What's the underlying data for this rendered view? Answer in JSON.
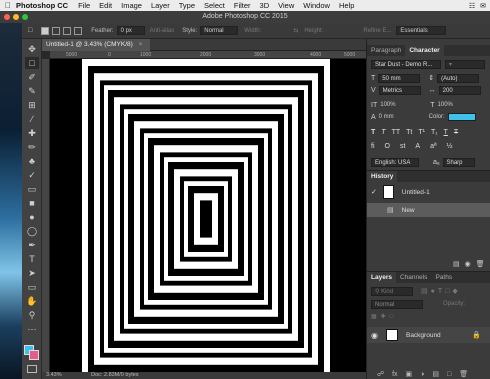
{
  "menubar": {
    "app_name": "Photoshop CC",
    "items": [
      "File",
      "Edit",
      "Image",
      "Layer",
      "Type",
      "Select",
      "Filter",
      "3D",
      "View",
      "Window",
      "Help"
    ]
  },
  "window": {
    "title": "Adobe Photoshop CC 2015"
  },
  "options": {
    "feather_label": "Feather:",
    "feather_value": "0 px",
    "antialias_label": "Anti-alias",
    "style_label": "Style:",
    "style_value": "Normal",
    "width_label": "Width:",
    "height_label": "Height:",
    "refine_label": "Refine E...",
    "workspace_value": "Essentials"
  },
  "document": {
    "tab_label": "Untitled-1 @ 3.43% (CMYK/8)",
    "ruler_ticks": [
      "5000",
      "0",
      "1000",
      "2000",
      "3000",
      "4000",
      "5000"
    ],
    "status_zoom": "3.43%",
    "status_doc": "Doc: 2.83M/0 bytes"
  },
  "character_panel": {
    "tabs": [
      "Paragraph",
      "Character"
    ],
    "font_family": "Star Dust - Demo R...",
    "font_size": "50 mm",
    "leading": "(Auto)",
    "kerning": "Metrics",
    "tracking": "200",
    "vertical_scale": "100%",
    "horizontal_scale": "100%",
    "baseline_shift": "0 mm",
    "color_label": "Color:",
    "color_value": "#3ec1ea",
    "language": "English: USA",
    "antialias": "Sharp"
  },
  "history_panel": {
    "title": "History",
    "snapshot": "Untitled-1",
    "states": [
      "New"
    ]
  },
  "layers_panel": {
    "tabs": [
      "Layers",
      "Channels",
      "Paths"
    ],
    "filter_placeholder": "Kind",
    "blend_mode": "Normal",
    "opacity_label": "Opacity:",
    "layers": [
      {
        "name": "Background"
      }
    ]
  }
}
